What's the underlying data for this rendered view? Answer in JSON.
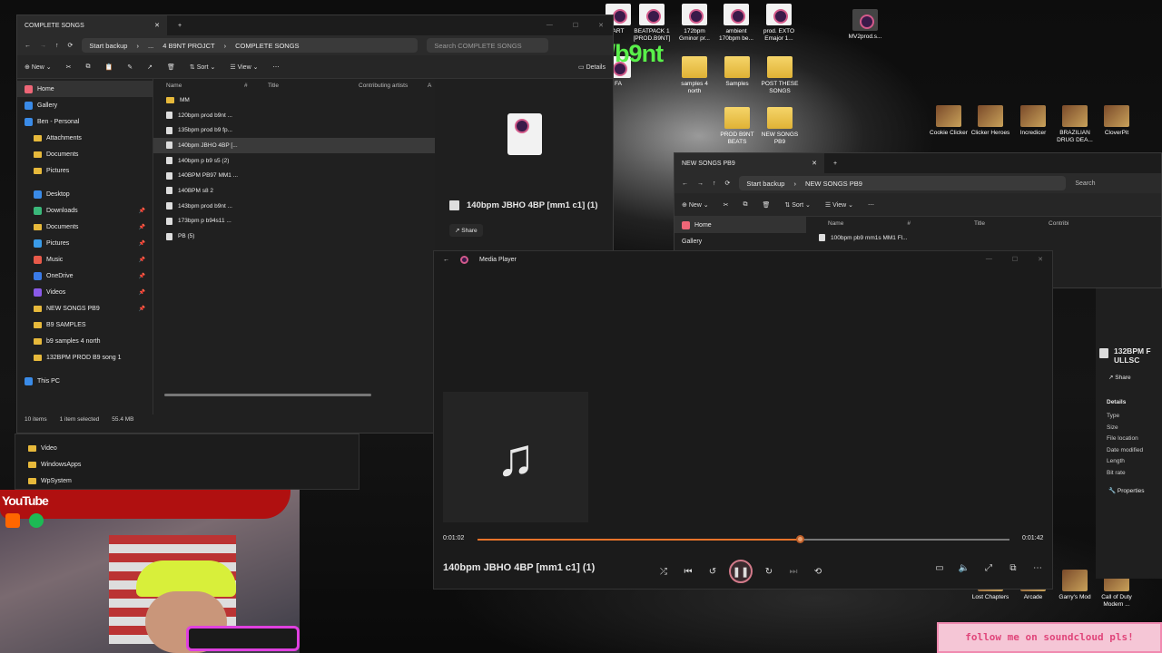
{
  "overlay": {
    "kick_text": "kick.com/b9nt",
    "youtube": "YouTube",
    "banner": "follow me on soundcloud pls!"
  },
  "desktop_icons": [
    {
      "label": "BEATPACK 1 [PROD.B9NT]",
      "kind": "mp"
    },
    {
      "label": "172bpm Gminor pr...",
      "kind": "mp"
    },
    {
      "label": "ambient 170bpm be...",
      "kind": "mp"
    },
    {
      "label": "prod. EXTO Emajor 1...",
      "kind": "mp"
    },
    {
      "label": "MV2prod.s...",
      "kind": "video"
    },
    {
      "label": "samples 4 north",
      "kind": "folder"
    },
    {
      "label": "Samples",
      "kind": "folder"
    },
    {
      "label": "POST THESE SONGS",
      "kind": "folder"
    },
    {
      "label": "PROD B9NT BEATS",
      "kind": "folder"
    },
    {
      "label": "NEW SONGS PB9",
      "kind": "folder"
    },
    {
      "label": "Cookie Clicker",
      "kind": "game"
    },
    {
      "label": "Clicker Heroes",
      "kind": "game"
    },
    {
      "label": "Incredicer",
      "kind": "game"
    },
    {
      "label": "BRAZILIAN DRUG DEA...",
      "kind": "game"
    },
    {
      "label": "CloverPit",
      "kind": "game"
    },
    {
      "label": "ART",
      "kind": "mp"
    },
    {
      "label": "FA",
      "kind": "mp"
    },
    {
      "label": "Garry's Mod",
      "kind": "game"
    },
    {
      "label": "Call of Duty Modern ...",
      "kind": "game"
    },
    {
      "label": "Lost Chapters",
      "kind": "game"
    },
    {
      "label": "Arcade",
      "kind": "game"
    }
  ],
  "explorer1": {
    "tab_title": "COMPLETE SONGS",
    "breadcrumb": [
      "Start backup",
      "...",
      "4 B9NT PROJCT",
      "COMPLETE SONGS"
    ],
    "search_placeholder": "Search COMPLETE SONGS",
    "toolbar": {
      "new": "New",
      "sort": "Sort",
      "view": "View",
      "details": "Details"
    },
    "sidebar": [
      "Home",
      "Gallery",
      "Ben - Personal",
      "Attachments",
      "Documents",
      "Pictures",
      "Desktop",
      "Downloads",
      "Documents",
      "Pictures",
      "Music",
      "OneDrive",
      "Videos",
      "NEW SONGS PB9",
      "B9 SAMPLES",
      "b9 samples 4 north",
      "132BPM PROD B9 song 1",
      "This PC",
      "Video",
      "WindowsApps",
      "WpSystem"
    ],
    "columns": [
      "Name",
      "#",
      "Title",
      "Contributing artists",
      "A"
    ],
    "files": [
      "MM",
      "120bpm prod b9nt ...",
      "135bpm prod b9 fp...",
      "140bpm JBHO 4BP [...",
      "140bpm p b9 s5 (2)",
      "140BPM PB97 MM1 ...",
      "140BPM s8 2",
      "143bpm prod b9nt ...",
      "173bpm p b94s11 ...",
      "PB (5)"
    ],
    "selected_index": 3,
    "status": [
      "10 items",
      "1 item selected",
      "55.4 MB"
    ],
    "preview_title": "140bpm JBHO 4BP [mm1 c1] (1)",
    "share": "Share"
  },
  "explorer2": {
    "tab_title": "NEW SONGS PB9",
    "breadcrumb": [
      "Start backup",
      "NEW SONGS PB9"
    ],
    "search_placeholder": "Search",
    "toolbar": {
      "new": "New",
      "sort": "Sort",
      "view": "View"
    },
    "sidebar": [
      "Home",
      "Gallery"
    ],
    "columns": [
      "Name",
      "#",
      "Title",
      "Contribi"
    ],
    "files": [
      "100bpm pb9 mm1s MM1 Fl..."
    ],
    "preview_title": "132BPM FULLSC",
    "share": "Share",
    "details_heading": "Details",
    "details_fields": [
      "Type",
      "Size",
      "File location",
      "Date modified",
      "Length",
      "Bit rate"
    ],
    "properties": "Properties"
  },
  "media_player": {
    "app_title": "Media Player",
    "track": "140bpm JBHO 4BP [mm1 c1] (1)",
    "elapsed": "0:01:02",
    "duration": "0:01:42",
    "progress": 0.605,
    "accent": "#e8732a"
  }
}
